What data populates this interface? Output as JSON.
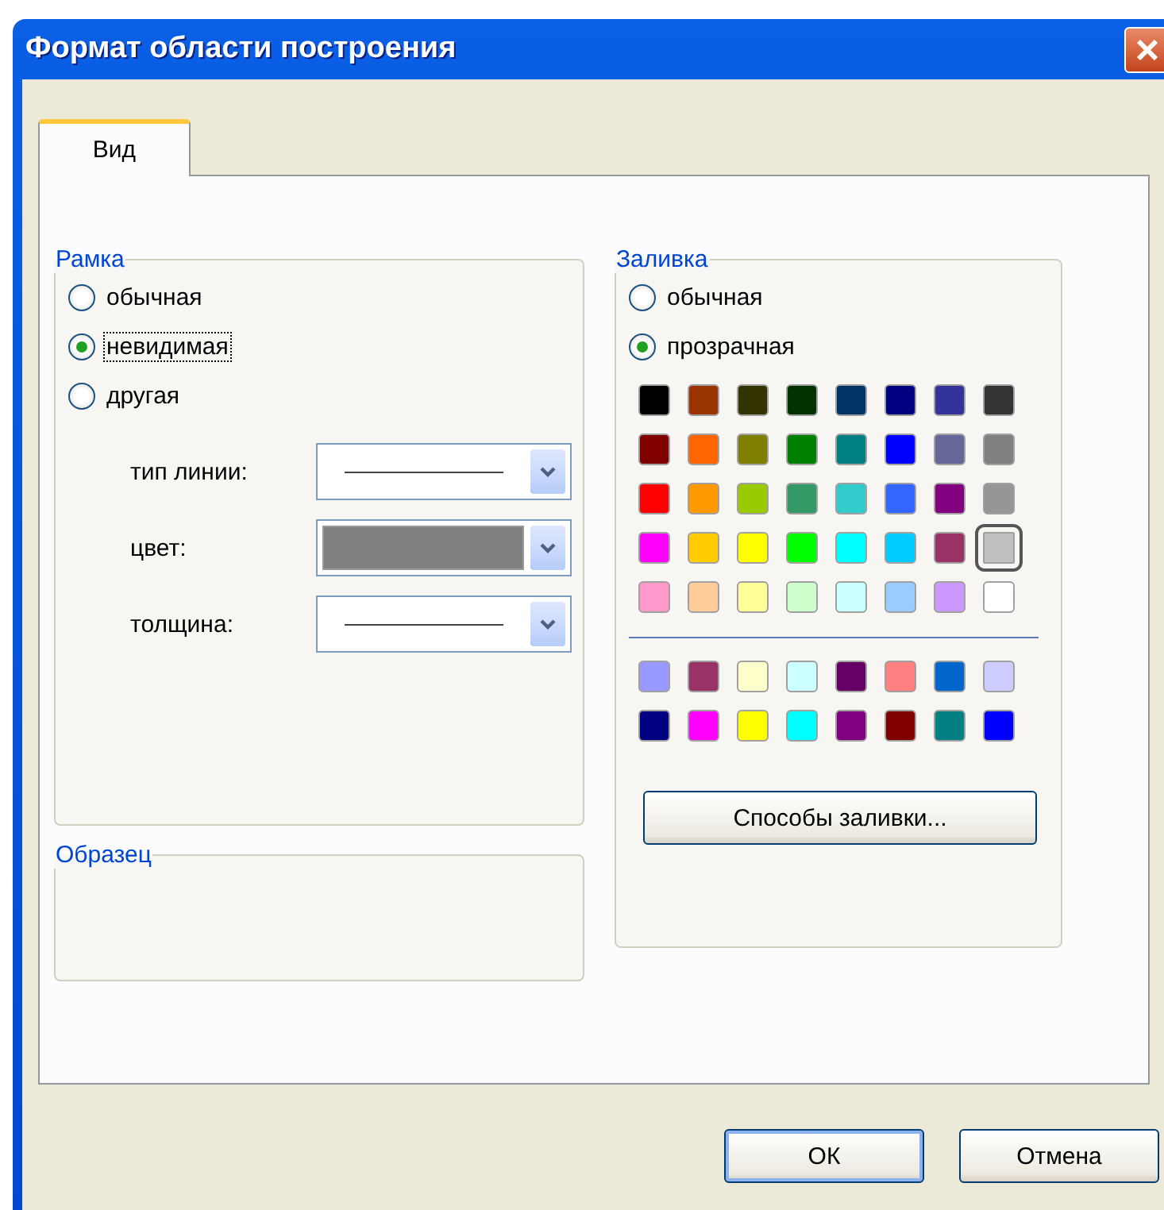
{
  "window": {
    "title": "Формат области построения"
  },
  "tabs": [
    {
      "label": "Вид",
      "selected": true
    }
  ],
  "border_group": {
    "title": "Рамка",
    "options": [
      {
        "label": "обычная",
        "selected": false,
        "focused": false
      },
      {
        "label": "невидимая",
        "selected": true,
        "focused": true
      },
      {
        "label": "другая",
        "selected": false,
        "focused": false
      }
    ],
    "fields": [
      {
        "label": "тип линии:",
        "kind": "line"
      },
      {
        "label": "цвет:",
        "kind": "color",
        "color": "#808080"
      },
      {
        "label": "толщина:",
        "kind": "line"
      }
    ]
  },
  "sample_group": {
    "title": "Образец"
  },
  "fill_group": {
    "title": "Заливка",
    "options": [
      {
        "label": "обычная",
        "selected": false,
        "focused": false
      },
      {
        "label": "прозрачная",
        "selected": true,
        "focused": false
      }
    ],
    "palette": [
      [
        {
          "color": "#000000",
          "selected": false
        },
        {
          "color": "#993300",
          "selected": false
        },
        {
          "color": "#333300",
          "selected": false
        },
        {
          "color": "#003300",
          "selected": false
        },
        {
          "color": "#003366",
          "selected": false
        },
        {
          "color": "#000080",
          "selected": false
        },
        {
          "color": "#333399",
          "selected": false
        },
        {
          "color": "#333333",
          "selected": false
        }
      ],
      [
        {
          "color": "#800000",
          "selected": false
        },
        {
          "color": "#ff6600",
          "selected": false
        },
        {
          "color": "#808000",
          "selected": false
        },
        {
          "color": "#008000",
          "selected": false
        },
        {
          "color": "#008080",
          "selected": false
        },
        {
          "color": "#0000ff",
          "selected": false
        },
        {
          "color": "#666699",
          "selected": false
        },
        {
          "color": "#808080",
          "selected": false
        }
      ],
      [
        {
          "color": "#ff0000",
          "selected": false
        },
        {
          "color": "#ff9900",
          "selected": false
        },
        {
          "color": "#99cc00",
          "selected": false
        },
        {
          "color": "#339966",
          "selected": false
        },
        {
          "color": "#33cccc",
          "selected": false
        },
        {
          "color": "#3366ff",
          "selected": false
        },
        {
          "color": "#800080",
          "selected": false
        },
        {
          "color": "#969696",
          "selected": false
        }
      ],
      [
        {
          "color": "#ff00ff",
          "selected": false
        },
        {
          "color": "#ffcc00",
          "selected": false
        },
        {
          "color": "#ffff00",
          "selected": false
        },
        {
          "color": "#00ff00",
          "selected": false
        },
        {
          "color": "#00ffff",
          "selected": false
        },
        {
          "color": "#00ccff",
          "selected": false
        },
        {
          "color": "#993366",
          "selected": false
        },
        {
          "color": "#c0c0c0",
          "selected": true
        }
      ],
      [
        {
          "color": "#ff99cc",
          "selected": false
        },
        {
          "color": "#ffcc99",
          "selected": false
        },
        {
          "color": "#ffff99",
          "selected": false
        },
        {
          "color": "#ccffcc",
          "selected": false
        },
        {
          "color": "#ccffff",
          "selected": false
        },
        {
          "color": "#99ccff",
          "selected": false
        },
        {
          "color": "#cc99ff",
          "selected": false
        },
        {
          "color": "#ffffff",
          "selected": false
        }
      ]
    ],
    "extra_palette": [
      [
        {
          "color": "#9999ff",
          "selected": false
        },
        {
          "color": "#993366",
          "selected": false
        },
        {
          "color": "#ffffcc",
          "selected": false
        },
        {
          "color": "#ccffff",
          "selected": false
        },
        {
          "color": "#660066",
          "selected": false
        },
        {
          "color": "#ff8080",
          "selected": false
        },
        {
          "color": "#0066cc",
          "selected": false
        },
        {
          "color": "#ccccff",
          "selected": false
        }
      ],
      [
        {
          "color": "#000080",
          "selected": false
        },
        {
          "color": "#ff00ff",
          "selected": false
        },
        {
          "color": "#ffff00",
          "selected": false
        },
        {
          "color": "#00ffff",
          "selected": false
        },
        {
          "color": "#800080",
          "selected": false
        },
        {
          "color": "#800000",
          "selected": false
        },
        {
          "color": "#008080",
          "selected": false
        },
        {
          "color": "#0000ff",
          "selected": false
        }
      ]
    ],
    "button": "Способы заливки..."
  },
  "buttons": [
    "ОК",
    "Отмена"
  ]
}
